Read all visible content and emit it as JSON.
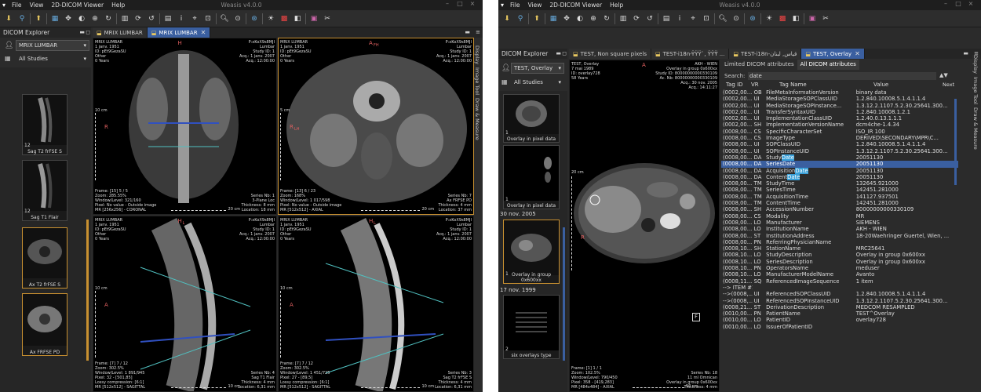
{
  "app": {
    "title": "Weasis v4.0.0",
    "menus": [
      "File",
      "View",
      "2D-DICOM Viewer",
      "Help"
    ]
  },
  "left": {
    "tabs": [
      {
        "label": "MRIX LUMBAR",
        "active": false
      },
      {
        "label": "MRIX LUMBAR",
        "active": true
      }
    ],
    "explorer_title": "DICOM Explorer",
    "patient_select": "MRIX LUMBAR",
    "study_select": "All Studies",
    "thumbnails": [
      {
        "num": "12",
        "caption": "Sag T2 frFSE S"
      },
      {
        "num": "12",
        "caption": "Sag T1 Flair"
      },
      {
        "num": "",
        "caption": "Ax T2 frFSE S"
      },
      {
        "num": "",
        "caption": "Ax FRFSE PD"
      }
    ],
    "views": [
      {
        "tl": "MRIX LUMBAR\n1 janv. 1951\nID: pEt9GezaSU\nOther\n0 Years",
        "tr": "P:xKoX9s8MJI\nLumbar\nStudy ID: 1\nAcq.: 1 janv. 2007\nAcq.: 12:00:00",
        "bl": "Frame: [15] 5 / 5\nZoom: 285.55%\nWindow/Level: 321/160\nPixel: No value - Outside image\nMR [256x256] - CORONAL",
        "br": "Series Nb: 1\n3-Plane Loc\nThickness: 8 mm\nLocation: 18 mm",
        "orient_top": "H",
        "orient_side": "R",
        "scale_label": "10 cm",
        "ruler_label": "20 cm"
      },
      {
        "tl": "MRIX LUMBAR\n1 janv. 1951\nID: pEt9GezaSU\nOther\n0 Years",
        "tr": "P:xKoX9s8MJI\nLumbar\nStudy ID: 1\nAcq.: 1 janv. 2007\nAcq.: 12:00:00",
        "bl": "Frame: [13] 6 / 23\nZoom: 168%\nWindow/Level: 1 017/598\nPixel: No value - Outside image\nMR [512x512] - AXIAL",
        "br": "Series Nb: 7\nAx FRFSE PD\nThickness: 4 mm\nLocation: 37 mm",
        "orient_top": "A",
        "orient_top_sub": "FH",
        "orient_side": "R",
        "orient_side_sub": "LH",
        "scale_label": "5 cm",
        "ruler_label": "20 cm"
      },
      {
        "tl": "MRIX LUMBAR\n1 janv. 1951\nID: pEt9GezaSU\nOther\n0 Years",
        "tr": "P:xKoX9s8MJI\nLumbar\nStudy ID: 1\nAcq.: 1 janv. 2007\nAcq.: 12:00:00",
        "bl": "Frame: [7] 7 / 12\nZoom: 302.5%\nWindow/Level: 1 891/945\nPixel: 32 - [501,85]\nLossy compression: [6:1]\nMR [512x512] - SAGITTAL",
        "br": "Series Nb: 4\nSag T1 Flair\nThickness: 4 mm\nLocation: 6,31 mm",
        "orient_top": "H",
        "orient_top_sub": "L",
        "orient_side": "A",
        "scale_label": "10 cm",
        "ruler_label": "10 cm"
      },
      {
        "tl": "MRIX LUMBAR\n1 janv. 1951\nID: pEt9GezaSU\nOther\n0 Years",
        "tr": "P:xKoX9s8MJI\nLumbar\nStudy ID: 1\nAcq.: 1 janv. 2007\nAcq.: 12:00:00",
        "bl": "Frame: [7] 7 / 12\nZoom: 302.5%\nWindow/Level: 1 451/725\nPixel: 27 - [89,5]\nLossy compression: [6:1]\nMR [512x512] - SAGITTAL",
        "br": "Series Nb: 3\nSag T2 frFSE S\nThickness: 4 mm\nLocation: 6,31 mm",
        "orient_top": "H",
        "orient_top_sub": "L",
        "orient_side": "A",
        "scale_label": "10 cm",
        "ruler_label": "10 cm"
      }
    ],
    "side_panels": [
      "Display",
      "Image Tool",
      "Draw & Measure"
    ]
  },
  "right": {
    "tabs": [
      {
        "label": "TEST, Non square pixels",
        "active": false
      },
      {
        "label": "TEST-i18n-ŸŸŸ`, ŸŸŸ̈ ...",
        "active": false
      },
      {
        "label": "TEST-i18n-قياس, لبنان",
        "active": false
      },
      {
        "label": "TEST, Overlay",
        "active": true
      }
    ],
    "explorer_title": "DICOM Explorer",
    "patient_select": "TEST, Overlay",
    "study_select": "All Studies",
    "thumbs": [
      {
        "num": "1",
        "caption": "Overlay in pixel data"
      },
      {
        "num": "1",
        "caption": "Overlay in pixel data"
      },
      {
        "num": "1",
        "caption": "Overlay in group 0x600xx"
      },
      {
        "num": "2",
        "caption": "six overlays type"
      }
    ],
    "dates": [
      "30 nov. 2005",
      "17 nov. 1999"
    ],
    "view": {
      "tl": "TEST, Overlay\n7 mai 1989\nID: overlay728\n58 Years",
      "tr": "AKH - WIEN\nOverlay in group 0x600xx\nStudy ID: 80000000000330109\nAc. Nb: 80000000000330109\nAcq.: 30 nov. 2005\nAcq.: 14:11:27",
      "bl": "Frame: [1] 1 / 1\nZoom: 102.5%\nWindow/Level: 790/450\nPixel: 358 - [419,283]\nMR [484x484] - AXIAL",
      "br": "Series Nb: 18\n11 ml Omnican\nOverlay in group 0x600xx\nThickness: 4 mm",
      "orient_top": "A",
      "orient_side": "R",
      "scale_label": "20 cm",
      "ruler_label": "50 cm",
      "letter": "F"
    },
    "attr_tabs": [
      "Limited DICOM attributes",
      "All DICOM attributes"
    ],
    "search_label": "Search:",
    "search_value": "date",
    "next_label": "Next",
    "columns": [
      "Tag ID",
      "VR",
      "Tag Name",
      "Value"
    ],
    "rows": [
      [
        "(0002,00...",
        "OB",
        "FileMetaInformationVersion",
        "binary data"
      ],
      [
        "(0002,00...",
        "UI",
        "MediaStorageSOPClassUID",
        "1.2.840.10008.5.1.4.1.1.4"
      ],
      [
        "(0002,00...",
        "UI",
        "MediaStorageSOPInstance...",
        "1.3.12.2.1107.5.2.30.25641.300..."
      ],
      [
        "(0002,00...",
        "UI",
        "TransferSyntaxUID",
        "1.2.840.10008.1.2.1"
      ],
      [
        "(0002,00...",
        "UI",
        "ImplementationClassUID",
        "1.2.40.0.13.1.1.1"
      ],
      [
        "(0002,00...",
        "SH",
        "ImplementationVersionName",
        "dcm4che-1.4.34"
      ],
      [
        "(0008,00...",
        "CS",
        "SpecificCharacterSet",
        "ISO_IR 100"
      ],
      [
        "(0008,00...",
        "CS",
        "ImageType",
        "DERIVED\\SECONDARY\\MPR\\C..."
      ],
      [
        "(0008,00...",
        "UI",
        "SOPClassUID",
        "1.2.840.10008.5.1.4.1.1.4"
      ],
      [
        "(0008,00...",
        "UI",
        "SOPInstanceUID",
        "1.3.12.2.1107.5.2.30.25641.300..."
      ],
      [
        "(0008,00...",
        "DA",
        "StudyDate",
        "20051130"
      ],
      [
        "(0008,00...",
        "DA",
        "SeriesDate",
        "20051130"
      ],
      [
        "(0008,00...",
        "DA",
        "AcquisitionDate",
        "20051130"
      ],
      [
        "(0008,00...",
        "DA",
        "ContentDate",
        "20051130"
      ],
      [
        "(0008,00...",
        "TM",
        "StudyTime",
        "132645.921000"
      ],
      [
        "(0008,00...",
        "TM",
        "SeriesTime",
        "142451.281000"
      ],
      [
        "(0008,00...",
        "TM",
        "AcquisitionTime",
        "141127.937501"
      ],
      [
        "(0008,00...",
        "TM",
        "ContentTime",
        "142451.281000"
      ],
      [
        "(0008,00...",
        "SH",
        "AccessionNumber",
        "80000000000330109"
      ],
      [
        "(0008,00...",
        "CS",
        "Modality",
        "MR"
      ],
      [
        "(0008,00...",
        "LO",
        "Manufacturer",
        "SIEMENS"
      ],
      [
        "(0008,00...",
        "LO",
        "InstitutionName",
        "AKH - WIEN"
      ],
      [
        "(0008,00...",
        "ST",
        "InstitutionAddress",
        "18-20Waehringer Guertel, Wien, ..."
      ],
      [
        "(0008,00...",
        "PN",
        "ReferringPhysicianName",
        ""
      ],
      [
        "(0008,10...",
        "SH",
        "StationName",
        "MRC25641"
      ],
      [
        "(0008,10...",
        "LO",
        "StudyDescription",
        "Overlay in group 0x600xx"
      ],
      [
        "(0008,10...",
        "LO",
        "SeriesDescription",
        "Overlay in group 0x600xx"
      ],
      [
        "(0008,10...",
        "PN",
        "OperatorsName",
        "meduser"
      ],
      [
        "(0008,10...",
        "LO",
        "ManufacturerModelName",
        "Avanto"
      ],
      [
        "(0008,11...",
        "SQ",
        "ReferencedImageSequence",
        "1 item"
      ],
      [
        "--> ITEM #1",
        "",
        "",
        ""
      ],
      [
        "-->(0008,...",
        "UI",
        "ReferencedSOPClassUID",
        "1.2.840.10008.5.1.4.1.1.4"
      ],
      [
        "-->(0008,...",
        "UI",
        "ReferencedSOPInstanceUID",
        "1.3.12.2.1107.5.2.30.25641.300..."
      ],
      [
        "(0008,21...",
        "ST",
        "DerivationDescription",
        "MEDCOM RESAMPLED"
      ],
      [
        "(0010,00...",
        "PN",
        "PatientName",
        "TEST^Overlay"
      ],
      [
        "(0010,00...",
        "LO",
        "PatientID",
        "overlay728"
      ],
      [
        "(0010,00...",
        "LO",
        "IssuerOfPatientID",
        ""
      ]
    ],
    "selected_row": 11,
    "side_panels": [
      "Display",
      "Image Tool",
      "Draw & Measure"
    ]
  },
  "colors": {
    "accent": "#3a5fa0",
    "highlight": "#3aa0d8",
    "orientation": "#e06060"
  }
}
